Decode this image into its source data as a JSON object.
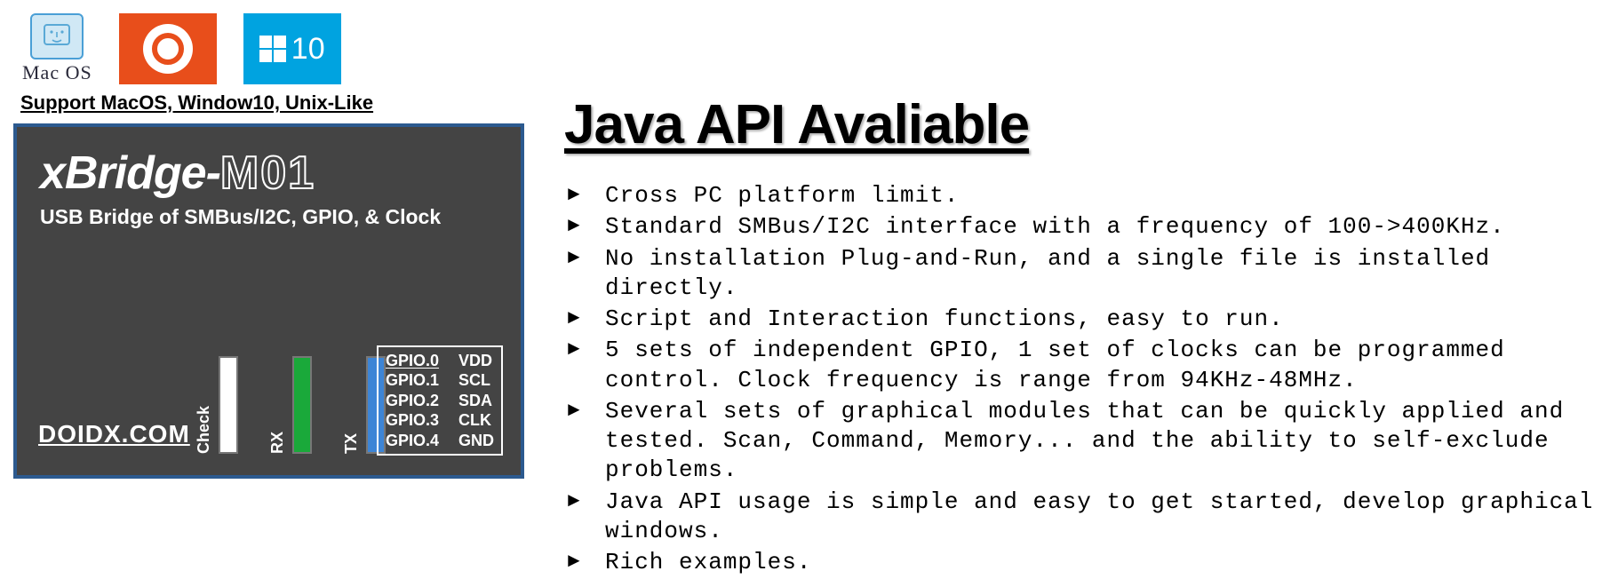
{
  "os": {
    "mac_label": "Mac OS",
    "win10_label": "10"
  },
  "support_caption": "Support MacOS, Window10, Unix-Like",
  "device": {
    "name_prefix": "xBridge-",
    "name_suffix": "M01",
    "subtitle": "USB Bridge of SMBus/I2C, GPIO, & Clock",
    "url": "DOIDX.COM",
    "leds": {
      "check": "Check",
      "rx": "RX",
      "tx": "TX"
    },
    "pins": [
      {
        "gpio": "GPIO.0",
        "sig": "VDD"
      },
      {
        "gpio": "GPIO.1",
        "sig": "SCL"
      },
      {
        "gpio": "GPIO.2",
        "sig": "SDA"
      },
      {
        "gpio": "GPIO.3",
        "sig": "CLK"
      },
      {
        "gpio": "GPIO.4",
        "sig": "GND"
      }
    ]
  },
  "heading": "Java API Avaliable",
  "bullets": [
    "Cross PC platform limit.",
    "Standard SMBus/I2C interface with a frequency of 100->400KHz.",
    "No installation Plug-and-Run, and a single file is installed directly.",
    "Script and Interaction functions, easy to run.",
    "5 sets of independent GPIO, 1 set of clocks can be programmed control. Clock frequency is range from 94KHz-48MHz.",
    "Several sets of graphical modules that can be quickly applied and tested. Scan, Command, Memory... and the ability to self-exclude problems.",
    "Java API usage is simple and easy to get started, develop graphical windows.",
    "Rich examples."
  ]
}
